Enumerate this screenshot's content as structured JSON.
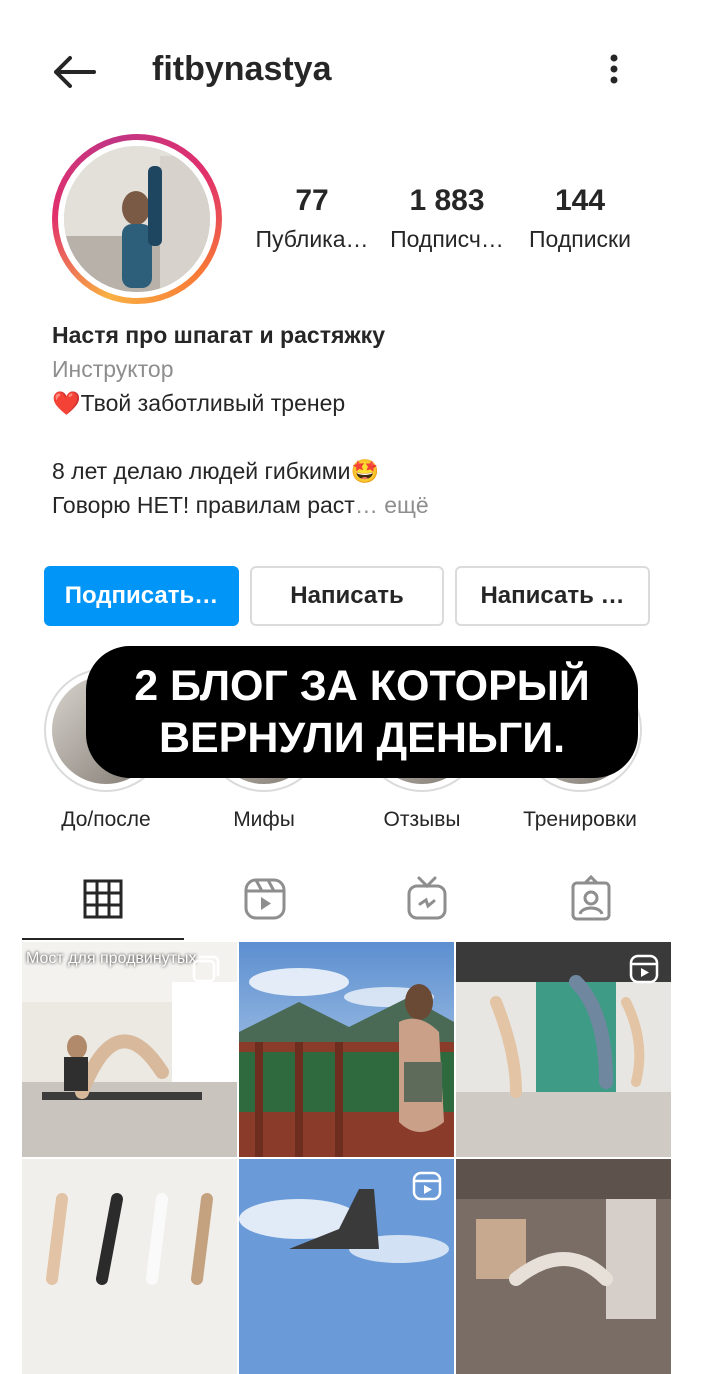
{
  "header": {
    "username": "fitbynastya",
    "back_icon": "arrow-left-icon",
    "menu_icon": "more-vertical-icon"
  },
  "stats": [
    {
      "value": "77",
      "label": "Публика…"
    },
    {
      "value": "1 883",
      "label": "Подписч…"
    },
    {
      "value": "144",
      "label": "Подписки"
    }
  ],
  "bio": {
    "name": "Настя про шпагат и растяжку",
    "category": "Инструктор",
    "line1": "❤️Твой заботливый тренер",
    "line2": "8 лет делаю людей гибкими🤩",
    "line3": "Говорю НЕТ! правилам раст",
    "more": "… ещё"
  },
  "buttons": {
    "follow": "Подписать…",
    "message": "Написать",
    "message2": "Написать …"
  },
  "highlights": [
    {
      "label": "До/после"
    },
    {
      "label": "Мифы"
    },
    {
      "label": "Отзывы"
    },
    {
      "label": "Тренировки"
    }
  ],
  "overlay": {
    "line1": "2 БЛОГ ЗА КОТОРЫЙ",
    "line2": "ВЕРНУЛИ ДЕНЬГИ."
  },
  "tabs": [
    {
      "icon": "grid-icon"
    },
    {
      "icon": "reels-icon"
    },
    {
      "icon": "igtv-icon"
    },
    {
      "icon": "tagged-icon"
    }
  ],
  "posts": [
    {
      "label": "Мост для продвинутых"
    }
  ],
  "colors": {
    "accent": "#0095f6",
    "text": "#262626",
    "muted": "#8e8e8e"
  }
}
